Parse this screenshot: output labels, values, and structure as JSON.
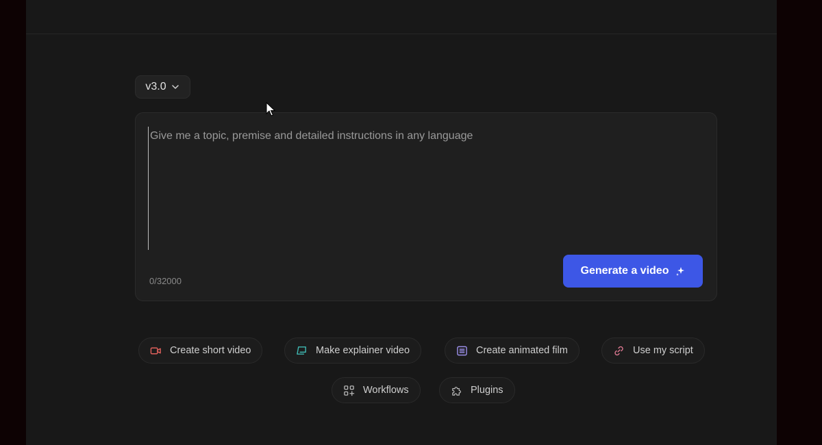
{
  "version": {
    "label": "v3.0",
    "icon": "chevron-down-icon"
  },
  "prompt": {
    "placeholder": "Give me a topic, premise and detailed instructions in any language",
    "value": "",
    "counter": "0/32000"
  },
  "generate": {
    "label": "Generate a video",
    "icon": "sparkle-icon",
    "color": "#3d57e6"
  },
  "actions": [
    {
      "label": "Create short video",
      "icon": "video-camera-icon",
      "color": "#e0615c"
    },
    {
      "label": "Make explainer video",
      "icon": "presentation-icon",
      "color": "#3fb9b3"
    },
    {
      "label": "Create animated film",
      "icon": "film-list-icon",
      "color": "#9a8ee8"
    },
    {
      "label": "Use my script",
      "icon": "link-icon",
      "color": "#e07a93"
    },
    {
      "label": "Workflows",
      "icon": "grid-plus-icon",
      "color": "#b8b8b8"
    },
    {
      "label": "Plugins",
      "icon": "puzzle-icon",
      "color": "#b8b8b8"
    }
  ],
  "colors": {
    "background": "#181818",
    "outer": "#0d0203",
    "panel": "#1f1f1f"
  }
}
